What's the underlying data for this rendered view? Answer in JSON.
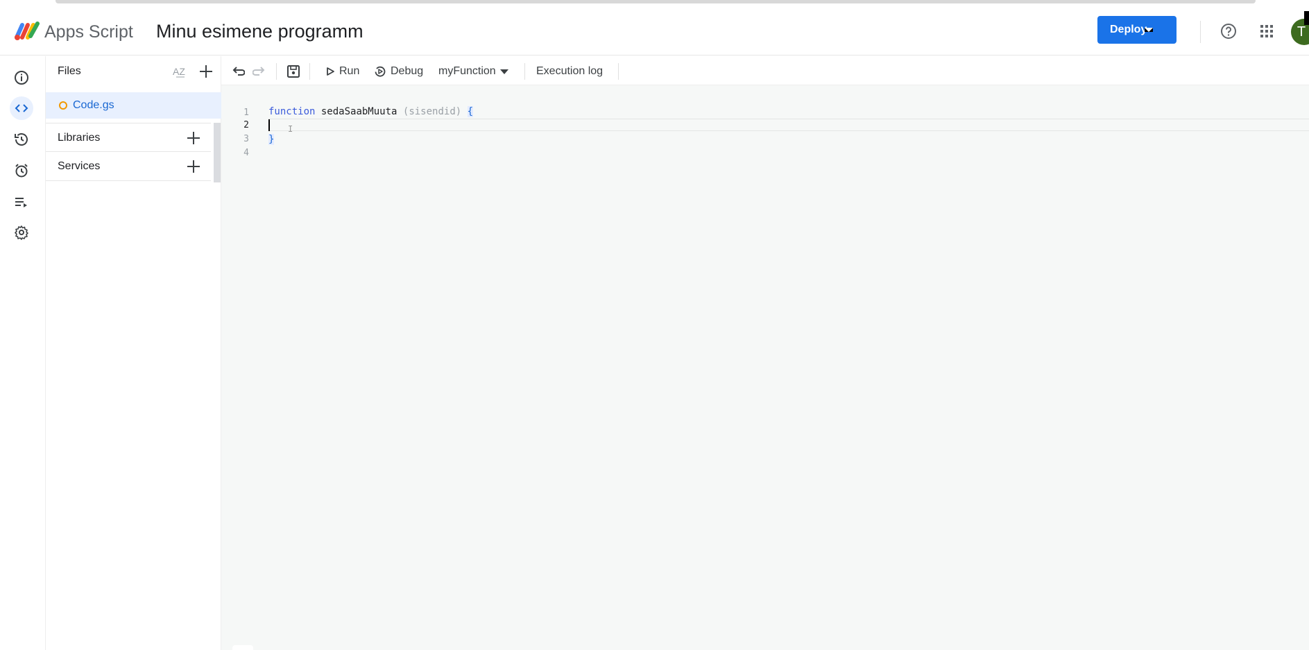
{
  "header": {
    "app_name": "Apps Script",
    "project_title": "Minu esimene programm",
    "deploy_label": "Deploy",
    "avatar_letter": "T"
  },
  "rail": {
    "items": [
      "info-icon",
      "code-editor-icon",
      "history-icon",
      "triggers-icon",
      "executions-icon",
      "settings-icon"
    ],
    "active": "code-editor-icon"
  },
  "files_panel": {
    "title": "Files",
    "files": [
      {
        "name": "Code.gs",
        "selected": true
      }
    ],
    "sections": [
      {
        "label": "Libraries"
      },
      {
        "label": "Services"
      }
    ]
  },
  "toolbar": {
    "run_label": "Run",
    "debug_label": "Debug",
    "function_select": "myFunction",
    "execution_log_label": "Execution log"
  },
  "editor": {
    "line_numbers": [
      "1",
      "2",
      "3",
      "4"
    ],
    "line1": {
      "keyword": "function",
      "name": "sedaSaabMuuta",
      "params": "(sisendid)",
      "brace": "{"
    },
    "line3_brace": "}"
  },
  "colors": {
    "accent": "#1a73e8",
    "selected_bg": "#e8f0fe",
    "editor_bg": "#f6f8f7",
    "avatar_bg": "#3d6b1f"
  }
}
